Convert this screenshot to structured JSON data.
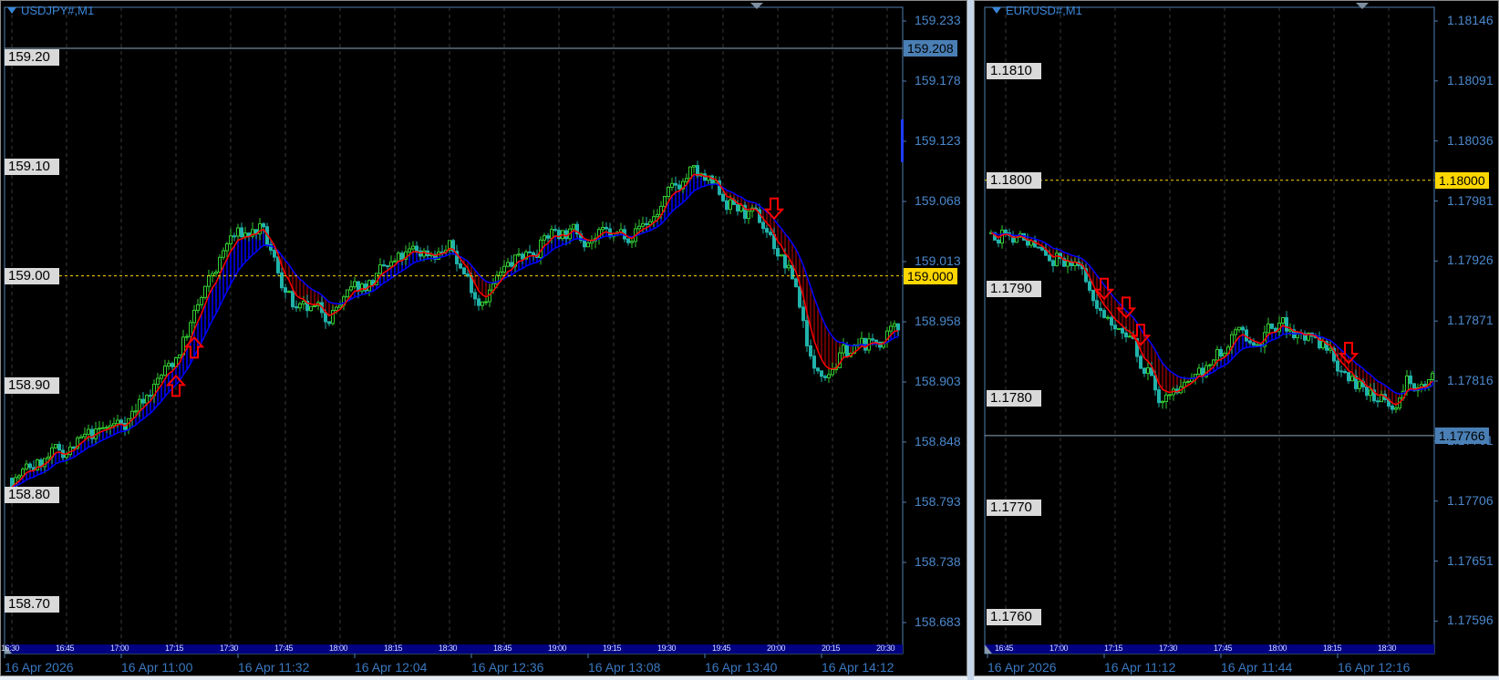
{
  "chart_data": [
    {
      "type": "candlestick",
      "symbol_label": "USDJPY#,M1",
      "price_axis": [
        "159.233",
        "159.178",
        "159.123",
        "159.068",
        "159.013",
        "158.958",
        "158.903",
        "158.848",
        "158.793",
        "158.738",
        "158.683"
      ],
      "level_labels": [
        "159.20",
        "159.10",
        "159.00",
        "158.90",
        "158.80",
        "158.70"
      ],
      "hlines": [
        {
          "price": "159.208",
          "style": "solid",
          "color": "#8fa6bd",
          "tag_color": "#4a7fb5"
        },
        {
          "price": "159.000",
          "style": "dashed",
          "color": "#ffd700",
          "tag_color": "#ffd700"
        }
      ],
      "time_labels": [
        "16:30",
        "16:45",
        "17:00",
        "17:15",
        "17:30",
        "17:45",
        "18:00",
        "18:15",
        "18:30",
        "18:45",
        "19:00",
        "19:15",
        "19:30",
        "19:45",
        "20:00",
        "20:15",
        "20:30"
      ],
      "date_labels": [
        "16 Apr 2026",
        "16 Apr 11:00",
        "16 Apr 11:32",
        "16 Apr 12:04",
        "16 Apr 12:36",
        "16 Apr 13:08",
        "16 Apr 13:40",
        "16 Apr 14:12"
      ],
      "approx_close": [
        [
          "16:30",
          158.815
        ],
        [
          "17:01",
          158.868
        ],
        [
          "17:14",
          158.92
        ],
        [
          "17:30",
          159.034
        ],
        [
          "17:38",
          159.042
        ],
        [
          "17:48",
          158.964
        ],
        [
          "17:56",
          158.964
        ],
        [
          "18:06",
          158.99
        ],
        [
          "18:20",
          159.02
        ],
        [
          "18:30",
          159.025
        ],
        [
          "18:38",
          158.98
        ],
        [
          "18:49",
          159.016
        ],
        [
          "18:59",
          159.042
        ],
        [
          "19:15",
          159.034
        ],
        [
          "19:25",
          159.051
        ],
        [
          "19:36",
          159.095
        ],
        [
          "19:46",
          159.069
        ],
        [
          "19:57",
          159.042
        ],
        [
          "20:05",
          158.99
        ],
        [
          "20:10",
          158.911
        ],
        [
          "20:18",
          158.929
        ],
        [
          "20:33",
          158.946
        ]
      ],
      "signals": [
        {
          "dir": "up",
          "time": "17:15"
        },
        {
          "dir": "up",
          "time": "17:20"
        },
        {
          "dir": "down",
          "time": "19:59"
        }
      ],
      "colors": {
        "bull": "#32cd32",
        "bear": "#20b2aa",
        "fast_ma": "#ff0000",
        "slow_ma": "#0000ff",
        "ribbon_up": "#0000ff",
        "ribbon_down": "#8b0000",
        "signal": "#ff0000"
      }
    },
    {
      "type": "candlestick",
      "symbol_label": "EURUSD#,M1",
      "price_axis": [
        "1.18146",
        "1.18091",
        "1.18036",
        "1.17981",
        "1.17926",
        "1.17871",
        "1.17816",
        "1.17761",
        "1.17706",
        "1.17651",
        "1.17596"
      ],
      "level_labels": [
        "1.1810",
        "1.1800",
        "1.1790",
        "1.1780",
        "1.1770",
        "1.1760"
      ],
      "hlines": [
        {
          "price": "1.18000",
          "style": "dashed",
          "color": "#ffd700",
          "tag_color": "#ffd700"
        },
        {
          "price": "1.17766",
          "style": "solid",
          "color": "#8fa6bd",
          "tag_color": "#4a7fb5"
        }
      ],
      "time_labels": [
        "16:45",
        "17:00",
        "17:15",
        "17:30",
        "17:45",
        "18:00",
        "18:15",
        "18:30"
      ],
      "date_labels": [
        "16 Apr 2026",
        "16 Apr 11:12",
        "16 Apr 11:44",
        "16 Apr 12:16"
      ],
      "approx_close": [
        [
          "16:41",
          1.17951
        ],
        [
          "16:45",
          1.17955
        ],
        [
          "16:55",
          1.17938
        ],
        [
          "17:03",
          1.17924
        ],
        [
          "17:08",
          1.17902
        ],
        [
          "17:16",
          1.17867
        ],
        [
          "17:24",
          1.17823
        ],
        [
          "17:28",
          1.17797
        ],
        [
          "17:35",
          1.1781
        ],
        [
          "17:40",
          1.17823
        ],
        [
          "17:48",
          1.17854
        ],
        [
          "17:58",
          1.17863
        ],
        [
          "18:04",
          1.17863
        ],
        [
          "18:11",
          1.1785
        ],
        [
          "18:22",
          1.17814
        ],
        [
          "18:30",
          1.17792
        ],
        [
          "18:32",
          1.17797
        ],
        [
          "18:35",
          1.17819
        ],
        [
          "18:42",
          1.17814
        ]
      ],
      "signals": [
        {
          "dir": "down",
          "time": "17:12"
        },
        {
          "dir": "down",
          "time": "17:18"
        },
        {
          "dir": "down",
          "time": "17:22"
        },
        {
          "dir": "down",
          "time": "18:19"
        }
      ],
      "colors": {
        "bull": "#32cd32",
        "bear": "#20b2aa",
        "fast_ma": "#ff0000",
        "slow_ma": "#0000ff",
        "ribbon_up": "#0000ff",
        "ribbon_down": "#8b0000",
        "signal": "#ff0000"
      }
    }
  ]
}
